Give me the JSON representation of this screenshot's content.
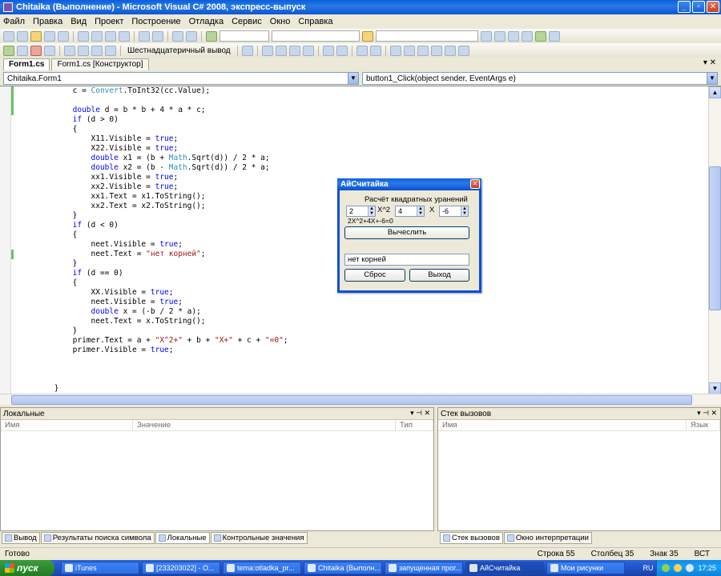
{
  "window": {
    "title": "Chitaika (Выполнение) - Microsoft Visual C# 2008, экспресс-выпуск"
  },
  "menu": [
    "Файл",
    "Правка",
    "Вид",
    "Проект",
    "Построение",
    "Отладка",
    "Сервис",
    "Окно",
    "Справка"
  ],
  "toolbar2": {
    "hex_label": "Шестнадцатеричный вывод"
  },
  "doc_tabs": [
    {
      "label": "Form1.cs",
      "active": true
    },
    {
      "label": "Form1.cs [Конструктор]",
      "active": false
    }
  ],
  "nav": {
    "class_combo": "Chitaika.Form1",
    "member_combo": "button1_Click(object sender, EventArgs e)"
  },
  "code_lines": [
    [
      {
        "t": "            c = "
      },
      {
        "t": "Convert",
        "c": "ty"
      },
      {
        "t": ".ToInt32(cc.Value);"
      }
    ],
    [
      {
        "t": ""
      }
    ],
    [
      {
        "t": "            "
      },
      {
        "t": "double",
        "c": "kw"
      },
      {
        "t": " d = b * b + 4 * a * c;"
      }
    ],
    [
      {
        "t": "            "
      },
      {
        "t": "if",
        "c": "kw"
      },
      {
        "t": " (d > 0)"
      }
    ],
    [
      {
        "t": "            {"
      }
    ],
    [
      {
        "t": "                X11.Visible = "
      },
      {
        "t": "true",
        "c": "kw"
      },
      {
        "t": ";"
      }
    ],
    [
      {
        "t": "                X22.Visible = "
      },
      {
        "t": "true",
        "c": "kw"
      },
      {
        "t": ";"
      }
    ],
    [
      {
        "t": "                "
      },
      {
        "t": "double",
        "c": "kw"
      },
      {
        "t": " x1 = (b + "
      },
      {
        "t": "Math",
        "c": "ty"
      },
      {
        "t": ".Sqrt(d)) / 2 * a;"
      }
    ],
    [
      {
        "t": "                "
      },
      {
        "t": "double",
        "c": "kw"
      },
      {
        "t": " x2 = (b - "
      },
      {
        "t": "Math",
        "c": "ty"
      },
      {
        "t": ".Sqrt(d)) / 2 * a;"
      }
    ],
    [
      {
        "t": "                xx1.Visible = "
      },
      {
        "t": "true",
        "c": "kw"
      },
      {
        "t": ";"
      }
    ],
    [
      {
        "t": "                xx2.Visible = "
      },
      {
        "t": "true",
        "c": "kw"
      },
      {
        "t": ";"
      }
    ],
    [
      {
        "t": "                xx1.Text = x1.ToString();"
      }
    ],
    [
      {
        "t": "                xx2.Text = x2.ToString();"
      }
    ],
    [
      {
        "t": "            }"
      }
    ],
    [
      {
        "t": "            "
      },
      {
        "t": "if",
        "c": "kw"
      },
      {
        "t": " (d < 0)"
      }
    ],
    [
      {
        "t": "            {"
      }
    ],
    [
      {
        "t": "                neet.Visible = "
      },
      {
        "t": "true",
        "c": "kw"
      },
      {
        "t": ";"
      }
    ],
    [
      {
        "t": "                neet.Text = "
      },
      {
        "t": "\"нет корней\"",
        "c": "st"
      },
      {
        "t": ";"
      }
    ],
    [
      {
        "t": "            }"
      }
    ],
    [
      {
        "t": "            "
      },
      {
        "t": "if",
        "c": "kw"
      },
      {
        "t": " (d == 0)"
      }
    ],
    [
      {
        "t": "            {"
      }
    ],
    [
      {
        "t": "                XX.Visible = "
      },
      {
        "t": "true",
        "c": "kw"
      },
      {
        "t": ";"
      }
    ],
    [
      {
        "t": "                neet.Visible = "
      },
      {
        "t": "true",
        "c": "kw"
      },
      {
        "t": ";"
      }
    ],
    [
      {
        "t": "                "
      },
      {
        "t": "double",
        "c": "kw"
      },
      {
        "t": " x = (-b / 2 * a);"
      }
    ],
    [
      {
        "t": "                neet.Text = x.ToString();"
      }
    ],
    [
      {
        "t": "            }"
      }
    ],
    [
      {
        "t": "            primer.Text = a + "
      },
      {
        "t": "\"X^2+\"",
        "c": "st"
      },
      {
        "t": " + b + "
      },
      {
        "t": "\"X+\"",
        "c": "st"
      },
      {
        "t": " + c + "
      },
      {
        "t": "\"=0\"",
        "c": "st"
      },
      {
        "t": ";"
      }
    ],
    [
      {
        "t": "            primer.Visible = "
      },
      {
        "t": "true",
        "c": "kw"
      },
      {
        "t": ";"
      }
    ],
    [
      {
        "t": ""
      }
    ],
    [
      {
        "t": ""
      }
    ],
    [
      {
        "t": ""
      }
    ],
    [
      {
        "t": "        }"
      }
    ]
  ],
  "app_dialog": {
    "title": "АйСчитайка",
    "heading": "Расчёт квадратных уранений",
    "a_value": "2",
    "x2_label": "X^2",
    "b_value": "4",
    "x_label": "X",
    "c_value": "-6",
    "equation": "2X^2+4X+-6=0",
    "calc_button": "Вычеслить",
    "result_text": "нет корней",
    "reset_button": "Сброс",
    "exit_button": "Выход"
  },
  "locals_panel": {
    "title": "Локальные",
    "columns": [
      "Имя",
      "Значение",
      "Тип"
    ]
  },
  "callstack_panel": {
    "title": "Стек вызовов",
    "columns": [
      "Имя",
      "Язык"
    ]
  },
  "bottom_tabs_left": [
    {
      "label": "Вывод",
      "active": false
    },
    {
      "label": "Результаты поиска символа",
      "active": false
    },
    {
      "label": "Локальные",
      "active": true
    },
    {
      "label": "Контрольные значения",
      "active": false
    }
  ],
  "bottom_tabs_right": [
    {
      "label": "Стек вызовов",
      "active": true
    },
    {
      "label": "Окно интерпретации",
      "active": false
    }
  ],
  "status": {
    "ready": "Готово",
    "row": "Строка 55",
    "col": "Столбец 35",
    "char": "Знак 35",
    "mode": "ВСТ"
  },
  "taskbar": {
    "start": "пуск",
    "tasks": [
      {
        "label": "iTunes",
        "active": false
      },
      {
        "label": "[233203022] - О...",
        "active": false
      },
      {
        "label": "tema:otladka_pr...",
        "active": false
      },
      {
        "label": "Chitaika (Выполн...",
        "active": false
      },
      {
        "label": "запущенная прог...",
        "active": false
      },
      {
        "label": "АйСчитайка",
        "active": true
      },
      {
        "label": "Мои рисунки",
        "active": false
      }
    ],
    "lang": "RU",
    "clock": "17:25"
  }
}
